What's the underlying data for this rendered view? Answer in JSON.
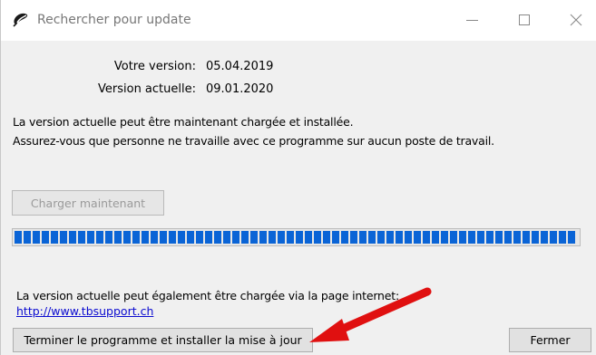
{
  "window": {
    "title": "Rechercher pour update"
  },
  "version": {
    "your_label": "Votre version:",
    "your_value": "05.04.2019",
    "current_label": "Version actuelle:",
    "current_value": "09.01.2020"
  },
  "messages": {
    "line1": "La version actuelle peut être maintenant chargée et installée.",
    "line2": "Assurez-vous que personne ne travaille avec ce programme sur aucun poste de travail.",
    "web_info": "La version actuelle peut également être chargée via la page internet:",
    "link": "http://www.tbsupport.ch"
  },
  "buttons": {
    "load_now": "Charger maintenant",
    "finish_install": "Terminer le programme et installer la mise à jour",
    "close": "Fermer"
  },
  "progress": {
    "percent": 100,
    "color": "#0a64d6"
  },
  "annotation": {
    "arrow_color": "#e01010"
  }
}
